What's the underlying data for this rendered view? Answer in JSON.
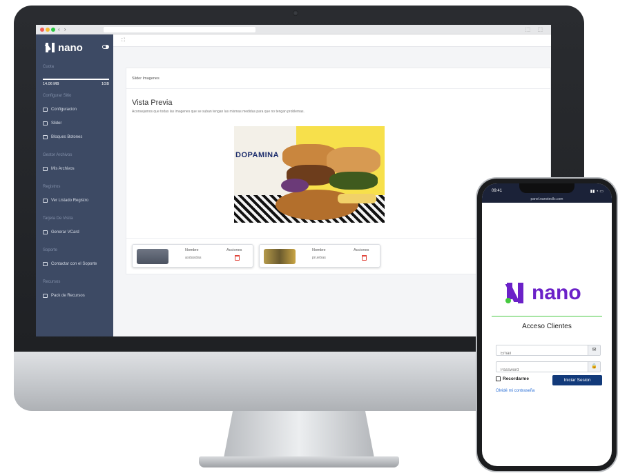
{
  "sidebar": {
    "logo_text": "nano",
    "sections": {
      "cuota": "Cuota",
      "configurar_sitio": "Configurar Sitio",
      "gestor_archivos": "Gestor Archivos",
      "registros": "Registros",
      "tarjeta_visita": "Tarjeta De Visita",
      "soporte": "Soporte",
      "recursos": "Recursos"
    },
    "quota": {
      "used": "14.06 MB",
      "total": "1GB"
    },
    "items": {
      "configuracion": "Configuracion",
      "slider": "Slider",
      "bloques_botones": "Bloques Botones",
      "mis_archivos": "Mis Archivos",
      "ver_listado": "Ver Listado Registro",
      "generar_vcard": "Generar VCard",
      "contactar_soporte": "Contactar con el Soporte",
      "pack_recursos": "Pack de Recursos"
    }
  },
  "main": {
    "card_header": "Slider Imagenes",
    "preview_title": "Vista Previa",
    "preview_desc": "Aconsejamos que todas las imagenes que se suban tengan las mismas medidas para que no tengan problemas.",
    "photo_brand": "DOPAMINA",
    "slides": [
      {
        "name_label": "Nombre",
        "actions_label": "Acciones",
        "name": "asdasdas"
      },
      {
        "name_label": "Nombre",
        "actions_label": "Acciones",
        "name": "pruebas"
      }
    ]
  },
  "phone": {
    "time": "09:41",
    "url": "panel.nanotecllc.com",
    "logo_text": "nano",
    "heading": "Acceso Clientes",
    "email_placeholder": "Email",
    "password_placeholder": "Password",
    "remember_label": "Recordarme",
    "login_button": "Iniciar Sesion",
    "forgot_link": "Olvidé mi contraseña"
  },
  "colors": {
    "sidebar_bg": "#3d4a64",
    "brand_purple": "#6b21c8",
    "brand_green": "#45c93f",
    "button_blue": "#123a7a"
  }
}
